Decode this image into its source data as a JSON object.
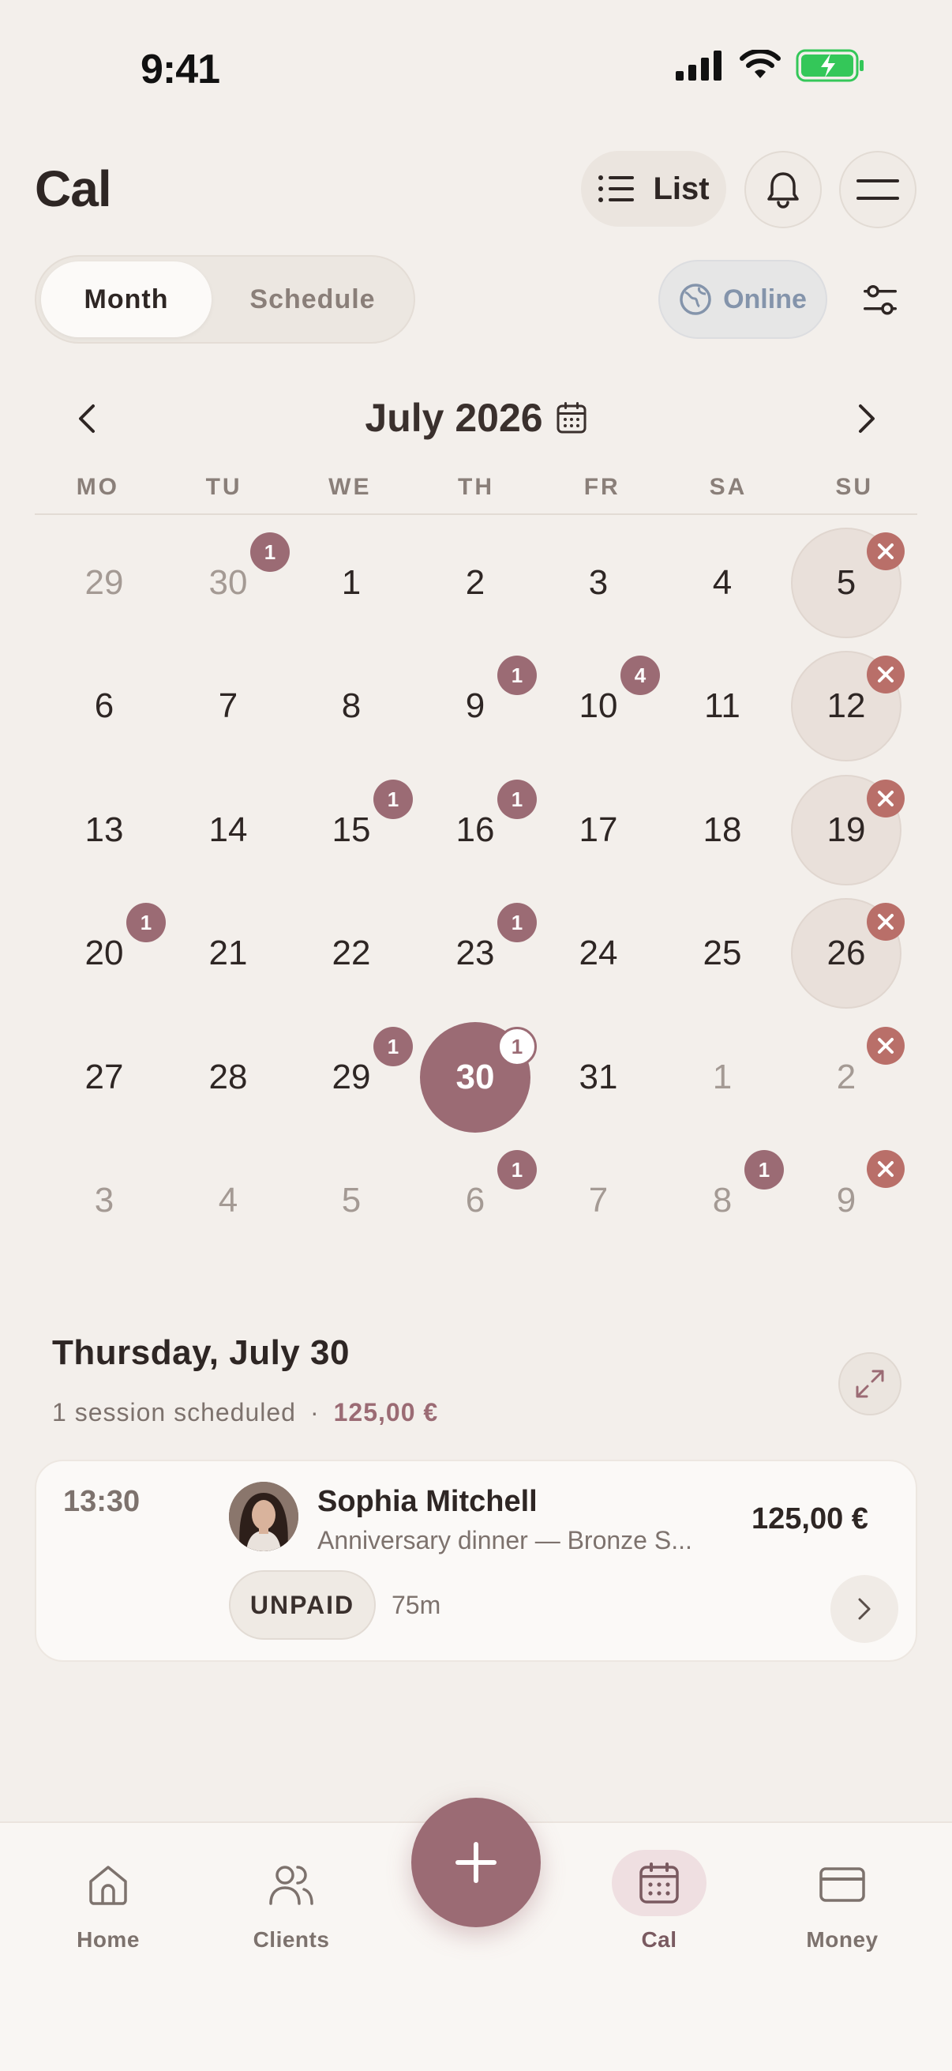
{
  "status_bar": {
    "time": "9:41"
  },
  "header": {
    "title": "Cal",
    "list_label": "List"
  },
  "view_toggle": {
    "month": "Month",
    "schedule": "Schedule",
    "selected": "Month"
  },
  "online_label": "Online",
  "calendar": {
    "month_label": "July 2026",
    "weekdays": [
      "MO",
      "TU",
      "WE",
      "TH",
      "FR",
      "SA",
      "SU"
    ],
    "weeks": [
      [
        {
          "d": "29",
          "other": true
        },
        {
          "d": "30",
          "other": true,
          "badge": "1"
        },
        {
          "d": "1"
        },
        {
          "d": "2"
        },
        {
          "d": "3"
        },
        {
          "d": "4"
        },
        {
          "d": "5",
          "closed": true,
          "x": true
        }
      ],
      [
        {
          "d": "6"
        },
        {
          "d": "7"
        },
        {
          "d": "8"
        },
        {
          "d": "9",
          "badge": "1"
        },
        {
          "d": "10",
          "badge": "4"
        },
        {
          "d": "11"
        },
        {
          "d": "12",
          "closed": true,
          "x": true
        }
      ],
      [
        {
          "d": "13"
        },
        {
          "d": "14"
        },
        {
          "d": "15",
          "badge": "1"
        },
        {
          "d": "16",
          "badge": "1"
        },
        {
          "d": "17"
        },
        {
          "d": "18"
        },
        {
          "d": "19",
          "closed": true,
          "x": true
        }
      ],
      [
        {
          "d": "20",
          "badge": "1"
        },
        {
          "d": "21"
        },
        {
          "d": "22"
        },
        {
          "d": "23",
          "badge": "1"
        },
        {
          "d": "24"
        },
        {
          "d": "25"
        },
        {
          "d": "26",
          "closed": true,
          "x": true
        }
      ],
      [
        {
          "d": "27"
        },
        {
          "d": "28"
        },
        {
          "d": "29",
          "badge": "1"
        },
        {
          "d": "30",
          "today": true,
          "badge": "1"
        },
        {
          "d": "31"
        },
        {
          "d": "1",
          "other": true
        },
        {
          "d": "2",
          "other": true,
          "x": true
        }
      ],
      [
        {
          "d": "3",
          "other": true
        },
        {
          "d": "4",
          "other": true
        },
        {
          "d": "5",
          "other": true
        },
        {
          "d": "6",
          "other": true,
          "badge": "1"
        },
        {
          "d": "7",
          "other": true
        },
        {
          "d": "8",
          "other": true,
          "badge": "1"
        },
        {
          "d": "9",
          "other": true,
          "x": true
        }
      ]
    ]
  },
  "day": {
    "title": "Thursday, July 30",
    "summary": "1 session scheduled",
    "separator": "·",
    "total": "125,00 €"
  },
  "session": {
    "time": "13:30",
    "client_name": "Sophia Mitchell",
    "description": "Anniversary dinner — Bronze S...",
    "price": "125,00 €",
    "status": "UNPAID",
    "duration": "75m"
  },
  "tabbar": {
    "home": "Home",
    "clients": "Clients",
    "cal": "Cal",
    "money": "Money",
    "active": "Cal"
  },
  "colors": {
    "accent": "#9b6b74",
    "background": "#f3efeb",
    "closed_x": "#b96f69",
    "online": "#8494ab"
  }
}
